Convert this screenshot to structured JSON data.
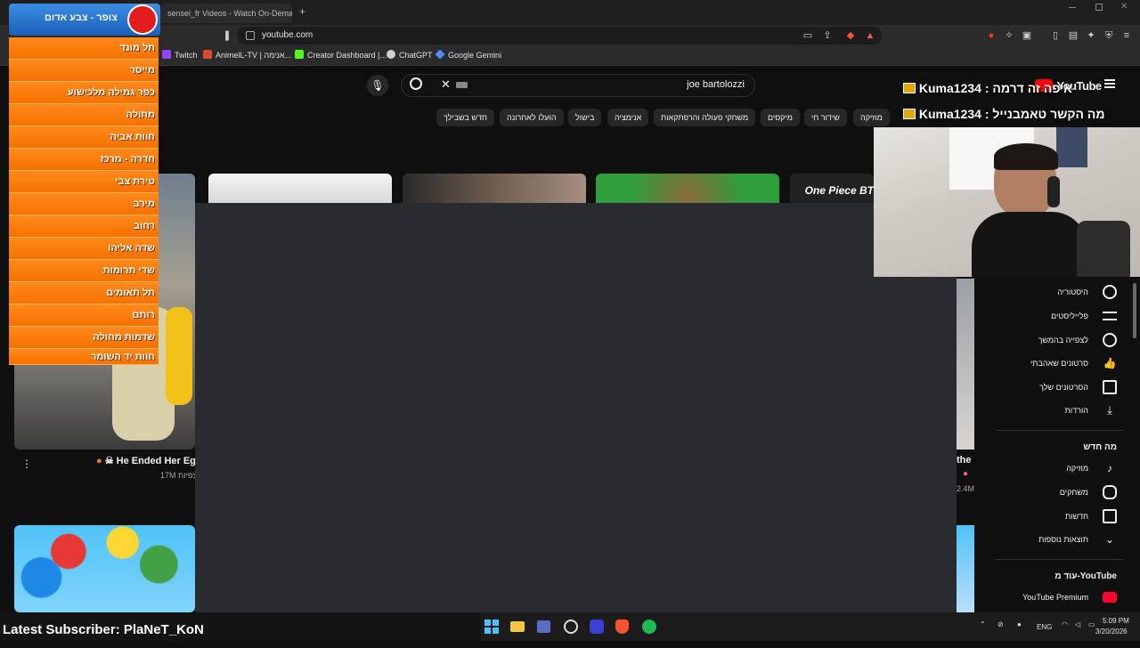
{
  "browser": {
    "tabs": [
      {
        "title": "sensei_fr Videos - Watch On-Demand"
      }
    ],
    "new_tab_label": "+",
    "url": "youtube.com",
    "bookmarks": [
      {
        "label": "Twitch",
        "color": "#9146ff"
      },
      {
        "label": "AnimelL-TV | אנימה...",
        "color": "#d94d2e"
      },
      {
        "label": "Creator Dashboard |...",
        "color": "#53fc18"
      },
      {
        "label": "ChatGPT",
        "color": "#cfcfcf"
      },
      {
        "label": "Google Gemini",
        "color": "#4f8bf9"
      }
    ]
  },
  "alert": {
    "title": "צופר - צבע אדום",
    "items": [
      "תל מונד",
      "מייסר",
      "כפר גמילה מלכישוע",
      "מחולה",
      "חוות אביה",
      "חדרה - מרכז",
      "טירת צבי",
      "מירב",
      "רחוב",
      "שדה אליהו",
      "שדי תרומות",
      "תל תאומים",
      "רותם",
      "שדמות מחולה",
      "חוות יד השומר"
    ]
  },
  "youtube": {
    "logo": "YouTube",
    "search_query": "joe bartolozzi",
    "chips": [
      "חדש בשבילך",
      "הועלו לאחרונה",
      "בישול",
      "אנימציה",
      "משחקי פעולה והרפתקאות",
      "מיקסים",
      "שידור חי",
      "מוזיקה"
    ],
    "thumbnail_text": "One Piece BT",
    "video_title": "He Ended Her Ego",
    "video_views": "17M צפיות",
    "right_video_title": "the",
    "right_video_views": "2.4M",
    "sidebar": [
      {
        "label": "היסטוריה",
        "icon": "history-icon"
      },
      {
        "label": "פלייליסטים",
        "icon": "playlist-icon"
      },
      {
        "label": "לצפייה בהמשך",
        "icon": "clock-icon"
      },
      {
        "label": "סרטונים שאהבתי",
        "icon": "thumbs-up-icon"
      },
      {
        "label": "הסרטונים שלך",
        "icon": "video-icon"
      },
      {
        "label": "הורדות",
        "icon": "download-icon"
      }
    ],
    "section_whats_new": "מה חדש",
    "explore": [
      {
        "label": "מוזיקה",
        "icon": "music-icon"
      },
      {
        "label": "משחקים",
        "icon": "gamepad-icon"
      },
      {
        "label": "חדשות",
        "icon": "news-icon"
      },
      {
        "label": "תוצאות נוספות",
        "icon": "chevron-down-icon"
      }
    ],
    "more_from": "עוד מ-YouTube",
    "premium": "YouTube Premium"
  },
  "stream": {
    "kuma_lines": [
      "Kuma1234 : איפה זה דרמה",
      "Kuma1234 : מה הקשר טאמבנייל"
    ],
    "latest_subscriber": "Latest Subscriber: PlaNeT_KoN"
  },
  "taskbar": {
    "lang": "ENG",
    "time": "5:09 PM",
    "date": "3/20/2026"
  }
}
